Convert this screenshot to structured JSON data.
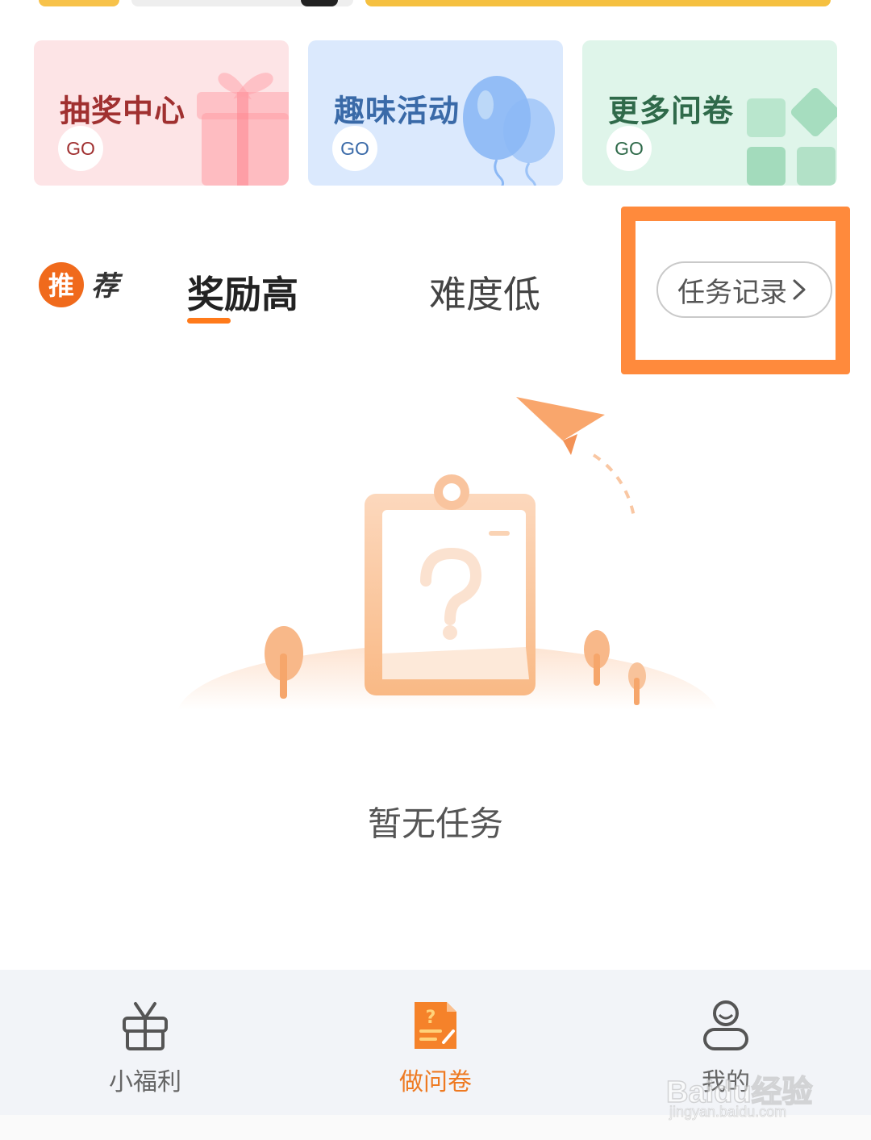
{
  "cards": [
    {
      "title": "抽奖中心",
      "go": "GO",
      "title_color": "#a03030",
      "bg": "#fde4e6"
    },
    {
      "title": "趣味活动",
      "go": "GO",
      "title_color": "#3a6aa8",
      "bg": "#dbe9fd"
    },
    {
      "title": "更多问卷",
      "go": "GO",
      "title_color": "#2f6a4a",
      "bg": "#dff5ea"
    }
  ],
  "recommend": {
    "logo_text": "推荐"
  },
  "tabs": [
    {
      "label": "奖励高",
      "active": true
    },
    {
      "label": "难度低",
      "active": false
    }
  ],
  "task_record": {
    "label": "任务记录"
  },
  "empty_state": {
    "message": "暂无任务"
  },
  "bottom_nav": [
    {
      "label": "小福利",
      "icon": "gift-icon",
      "active": false
    },
    {
      "label": "做问卷",
      "icon": "questionnaire-icon",
      "active": true
    },
    {
      "label": "我的",
      "icon": "profile-icon",
      "active": false
    }
  ],
  "watermark": {
    "text": "Baidu经验",
    "url": "jingyan.baidu.com"
  },
  "colors": {
    "accent": "#ff7a1a",
    "highlight": "#ff8a3c",
    "active_nav": "#ee7a22",
    "inactive_nav": "#666666"
  }
}
